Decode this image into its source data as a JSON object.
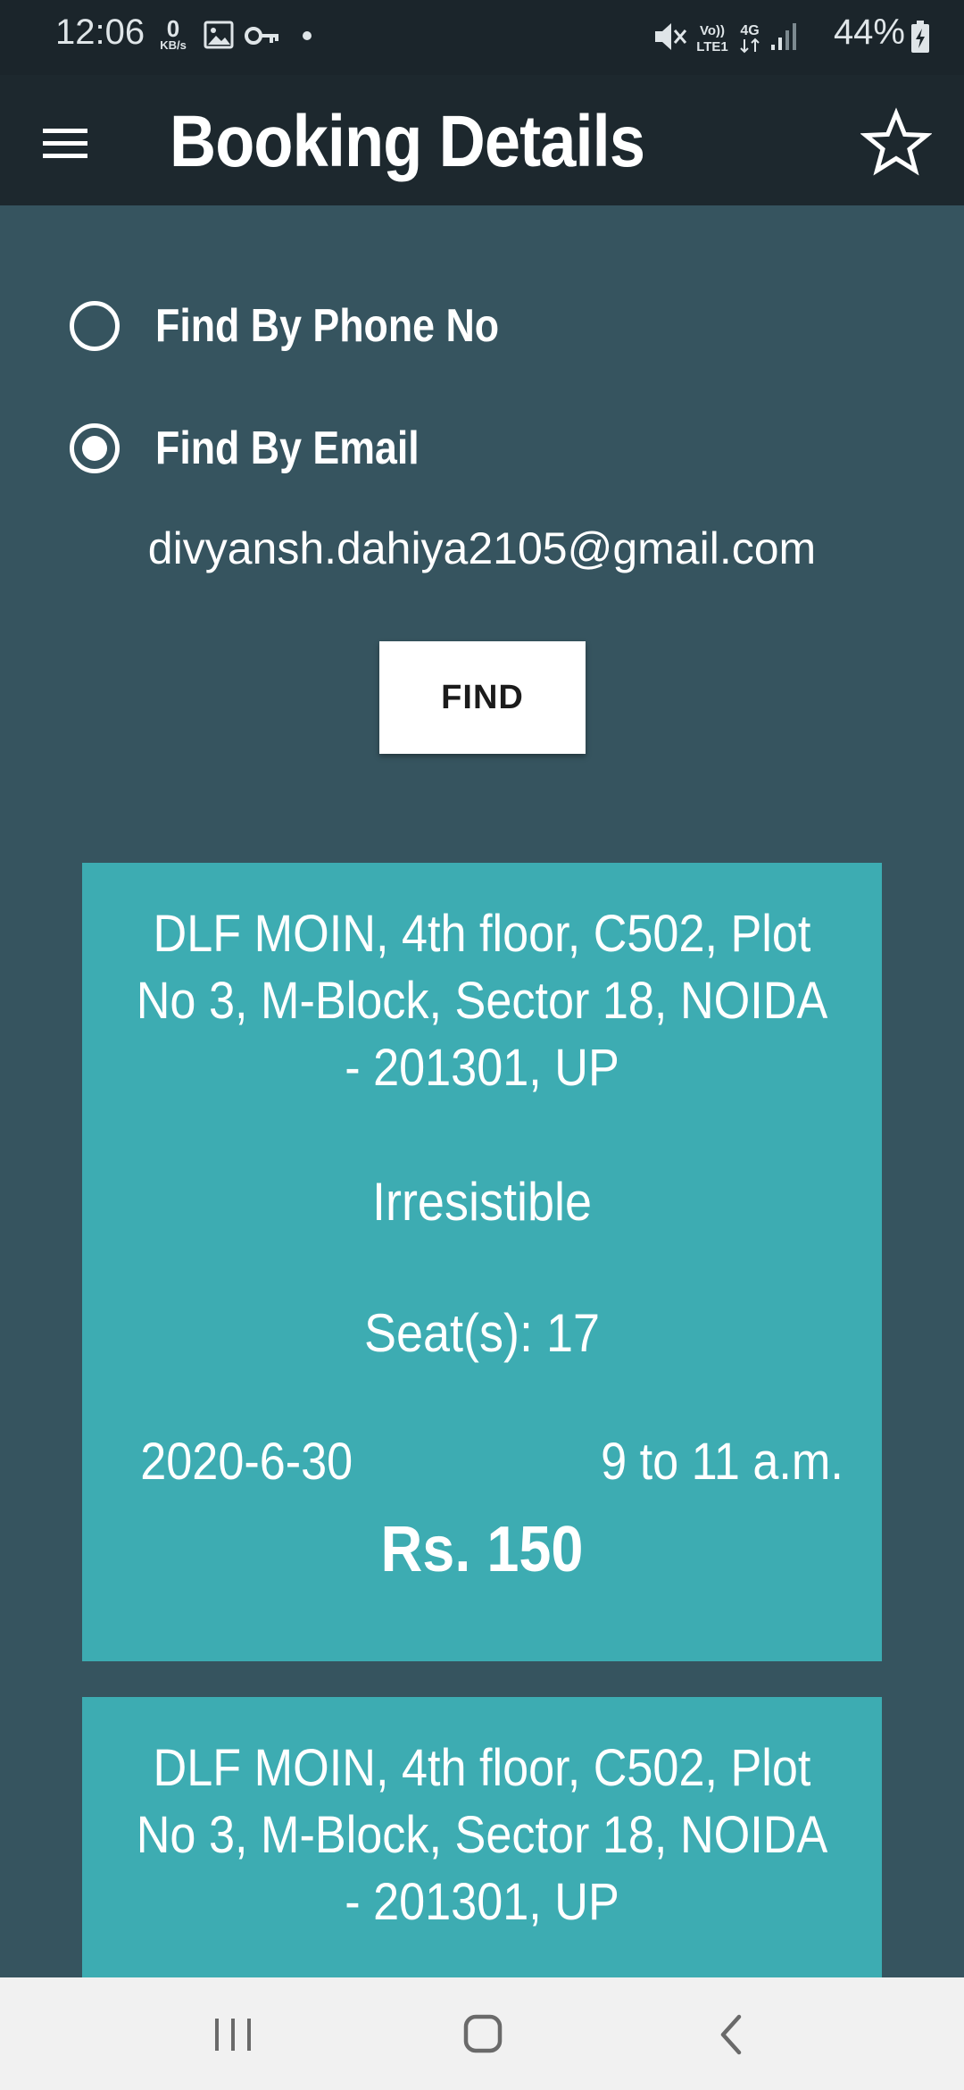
{
  "status_bar": {
    "time": "12:06",
    "net_speed": "0",
    "net_unit": "KB/s",
    "battery": "44%",
    "icons": [
      "image-icon",
      "key-icon",
      "dot-icon",
      "mute-icon",
      "volte-icon",
      "4g-icon",
      "signal-icon",
      "battery-charging-icon"
    ]
  },
  "app_bar": {
    "title": "Booking Details",
    "menu_icon": "hamburger-menu-icon",
    "action_icon": "star-outline-icon"
  },
  "search": {
    "options": [
      {
        "label": "Find By Phone No",
        "selected": false
      },
      {
        "label": "Find By Email",
        "selected": true
      }
    ],
    "email_value": "divyansh.dahiya2105@gmail.com",
    "find_label": "FIND"
  },
  "bookings": [
    {
      "address": "DLF MOIN, 4th floor, C502, Plot No 3, M-Block, Sector 18, NOIDA - 201301, UP",
      "title": "Irresistible",
      "seats": "Seat(s): 17",
      "date": "2020-6-30",
      "time": "9 to 11 a.m.",
      "price": "Rs. 150"
    },
    {
      "address": "DLF MOIN, 4th floor, C502, Plot No 3, M-Block, Sector 18, NOIDA - 201301, UP"
    }
  ],
  "colors": {
    "status_bar": "#1b252b",
    "app_bar": "#1d282e",
    "background": "#36545f",
    "card": "#3dacb2",
    "nav_bar": "#f1f1f1"
  }
}
